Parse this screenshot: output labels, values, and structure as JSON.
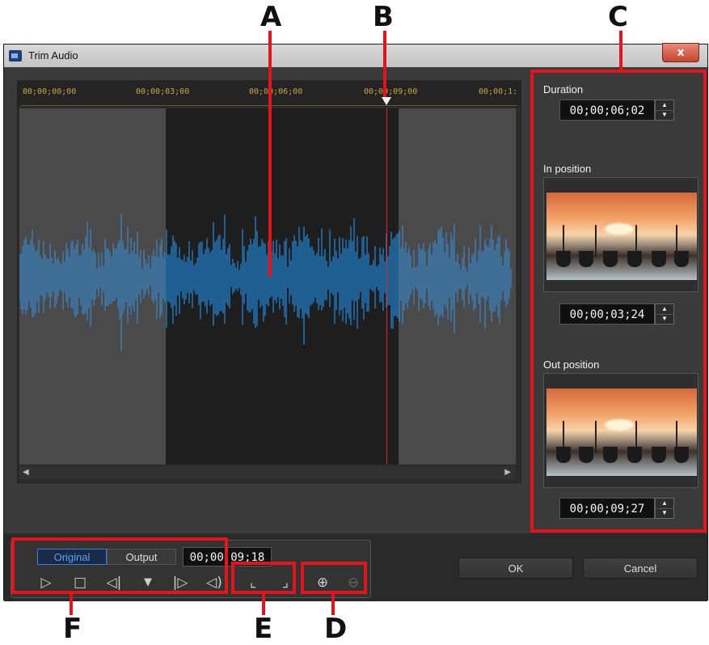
{
  "window": {
    "title": "Trim Audio",
    "close_glyph": "x"
  },
  "ruler": {
    "ticks": [
      "00;00;00;00",
      "00;00;03;00",
      "00;00;06;00",
      "00;00;09;00",
      "00;00;1:"
    ]
  },
  "waveform": {
    "selection_start_fraction": 0.295,
    "selection_end_fraction": 0.764,
    "playhead_fraction": 0.74,
    "colors": {
      "active": "#1f5f92",
      "inactive": "#3f6f96",
      "playhead": "#e0262b"
    }
  },
  "panel": {
    "duration_label": "Duration",
    "duration_value": "00;00;06;02",
    "in_label": "In position",
    "in_value": "00;00;03;24",
    "out_label": "Out position",
    "out_value": "00;00;09;27"
  },
  "controls": {
    "tab_original": "Original",
    "tab_output": "Output",
    "timecode": "00;00;09;18",
    "icons": [
      "play-icon",
      "stop-icon",
      "previous-frame-icon",
      "mark-in-icon",
      "next-frame-icon",
      "volume-icon",
      "in-position-icon",
      "out-position-icon",
      "zoom-in-icon",
      "zoom-out-icon"
    ]
  },
  "buttons": {
    "ok": "OK",
    "cancel": "Cancel"
  },
  "callouts": {
    "a": "A",
    "b": "B",
    "c": "C",
    "d": "D",
    "e": "E",
    "f": "F"
  }
}
